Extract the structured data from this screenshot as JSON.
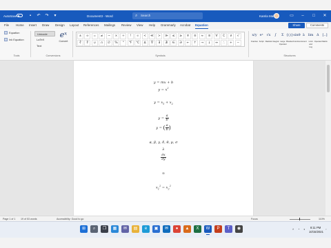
{
  "title_bar": {
    "autosave_label": "AutoSave",
    "document_name": "Document3 - Word",
    "search_placeholder": "Search",
    "user_name": "Kamla Malik",
    "icons": [
      "save-icon",
      "undo-icon",
      "redo-icon",
      "customize-icon"
    ]
  },
  "menu": {
    "items": [
      "File",
      "Home",
      "Insert",
      "Draw",
      "Design",
      "Layout",
      "References",
      "Mailings",
      "Review",
      "View",
      "Help",
      "Grammarly",
      "Acrobat",
      "Equation"
    ],
    "active": "Equation",
    "share_label": "Share",
    "comments_label": "Comments"
  },
  "ribbon": {
    "tools": {
      "equation_label": "Equation",
      "ink_equation_label": "Ink Equation",
      "group_label": "Tools"
    },
    "conversions": {
      "unicode_label": "Unicode",
      "latex_label": "LaTeX",
      "text_label": "Text",
      "convert_label": "Convert",
      "group_label": "Conversions"
    },
    "symbols": {
      "row1": [
        "±",
        "∞",
        "=",
        "≠",
        "~",
        "×",
        "÷",
        "!",
        "∝",
        "<",
        "≪",
        ">",
        "≫",
        "≤",
        "≥",
        "∓",
        "≅",
        "≈",
        "≡",
        "∀",
        "∁",
        "∂",
        "√"
      ],
      "row2": [
        "∛",
        "∜",
        "∪",
        "∩",
        "∅",
        "%",
        "°",
        "℉",
        "℃",
        "∆",
        "∇",
        "∃",
        "∄",
        "∈",
        "∋",
        "←",
        "↑",
        "→",
        "↓",
        "↔",
        "∴",
        "+",
        "−"
      ],
      "group_label": "Symbols"
    },
    "structures": {
      "items": [
        {
          "label": "Fraction",
          "glyph": "x/y"
        },
        {
          "label": "Script",
          "glyph": "eˣ"
        },
        {
          "label": "Radical",
          "glyph": "√x"
        },
        {
          "label": "Integral",
          "glyph": "∫"
        },
        {
          "label": "Large Operator",
          "glyph": "Σ"
        },
        {
          "label": "Bracket",
          "glyph": "{()}"
        },
        {
          "label": "Function",
          "glyph": "sinθ"
        },
        {
          "label": "Accent",
          "glyph": "ä"
        },
        {
          "label": "Limit and Log",
          "glyph": "lim"
        },
        {
          "label": "Operator",
          "glyph": "Δ"
        },
        {
          "label": "Matrix",
          "glyph": "[..]"
        }
      ],
      "group_label": "Structures"
    }
  },
  "document": {
    "equations": [
      "y = mx + b",
      "y = x²",
      "y = x₁ + x₂",
      "y = a/b",
      "y = (a/b)",
      "α, β, γ, δ, θ, μ, σ",
      "λ",
      "∂x/∂y",
      "∞",
      "x₁² = x₂²"
    ]
  },
  "status_bar": {
    "page": "Page 1 of 1",
    "words": "19 of 53 words",
    "accessibility": "Accessibility: Good to go",
    "focus": "Focus",
    "zoom": "110%"
  },
  "taskbar": {
    "clock_time": "8:11 PM",
    "clock_date": "10/15/2021",
    "icons": [
      "start-icon",
      "search-icon",
      "task-view-icon",
      "widgets-icon",
      "chat-icon",
      "explorer-icon",
      "edge-icon",
      "store-icon",
      "mail-icon",
      "chrome-icon",
      "photos-icon",
      "excel-icon",
      "word-icon",
      "powerpoint-icon",
      "teams-icon",
      "camera-icon"
    ]
  }
}
